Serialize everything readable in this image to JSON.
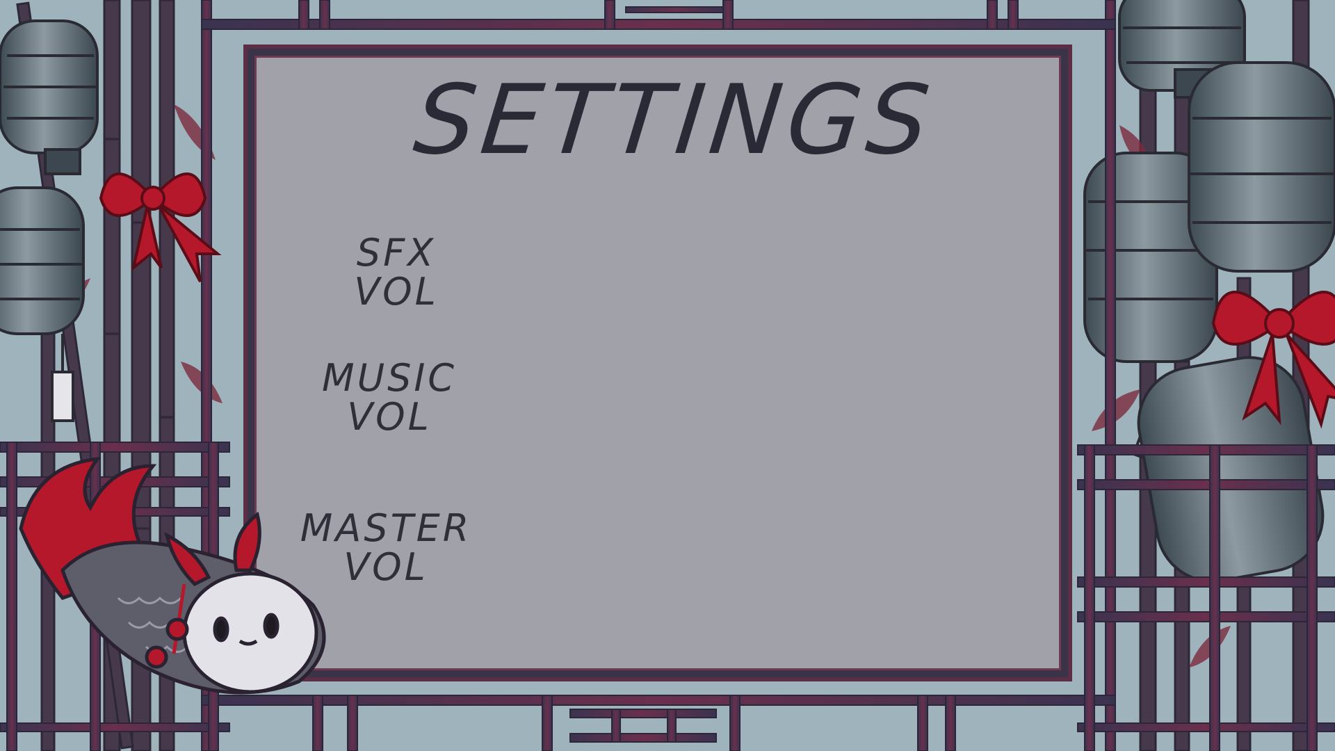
{
  "screen": {
    "title": "SETTINGS",
    "options": [
      {
        "line1": "SFX",
        "line2": "VOL"
      },
      {
        "line1": "MUSIC",
        "line2": "VOL"
      },
      {
        "line1": "MASTER",
        "line2": "VOL"
      }
    ]
  },
  "colors": {
    "sky": "#9fb3bd",
    "panel": "#a1a1a9",
    "frame": "#3b3449",
    "frame_accent": "#6e3a52",
    "ribbon": "#b5172b",
    "lantern": "#5f6c73",
    "text": "#2a2a36"
  },
  "icons": [
    "lantern-icon",
    "bamboo-icon",
    "red-bow-icon",
    "koi-fish-mascot-icon"
  ]
}
